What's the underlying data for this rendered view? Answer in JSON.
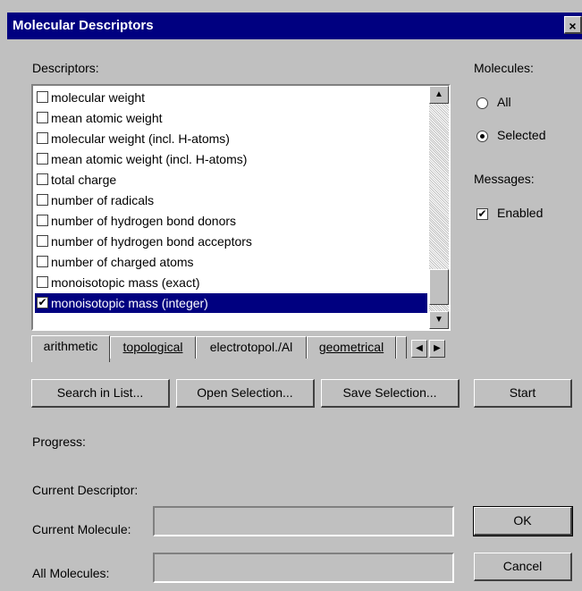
{
  "window": {
    "title": "Molecular Descriptors",
    "close_glyph": "×"
  },
  "descriptors": {
    "label": "Descriptors:",
    "items": [
      {
        "label": "molecular weight",
        "checked": false
      },
      {
        "label": "mean atomic weight",
        "checked": false
      },
      {
        "label": "molecular weight (incl. H-atoms)",
        "checked": false
      },
      {
        "label": "mean atomic weight (incl. H-atoms)",
        "checked": false
      },
      {
        "label": "total charge",
        "checked": false
      },
      {
        "label": "number of radicals",
        "checked": false
      },
      {
        "label": "number of hydrogen bond donors",
        "checked": false
      },
      {
        "label": "number of hydrogen bond acceptors",
        "checked": false
      },
      {
        "label": "number of charged atoms",
        "checked": false
      },
      {
        "label": "monoisotopic mass (exact)",
        "checked": false
      },
      {
        "label": "monoisotopic mass (integer)",
        "checked": true,
        "selected": true
      }
    ],
    "tabs": [
      {
        "label": "arithmetic",
        "active": true
      },
      {
        "label": "topological"
      },
      {
        "label": "electrotopol./Al"
      },
      {
        "label": "geometrical"
      }
    ]
  },
  "molecules": {
    "label": "Molecules:",
    "options": [
      {
        "label": "All",
        "selected": false
      },
      {
        "label": "Selected",
        "selected": true
      }
    ]
  },
  "messages": {
    "label": "Messages:",
    "enabled_label": "Enabled",
    "enabled": true
  },
  "buttons": {
    "search": "Search in List...",
    "open": "Open Selection...",
    "save": "Save Selection...",
    "start": "Start",
    "ok": "OK",
    "cancel": "Cancel"
  },
  "status": {
    "progress": "Progress:",
    "current_descriptor": "Current Descriptor:",
    "current_molecule": "Current Molecule:",
    "all_molecules": "All Molecules:"
  },
  "glyphs": {
    "check": "✔",
    "up": "▲",
    "down": "▼",
    "left": "◀",
    "right": "▶"
  }
}
